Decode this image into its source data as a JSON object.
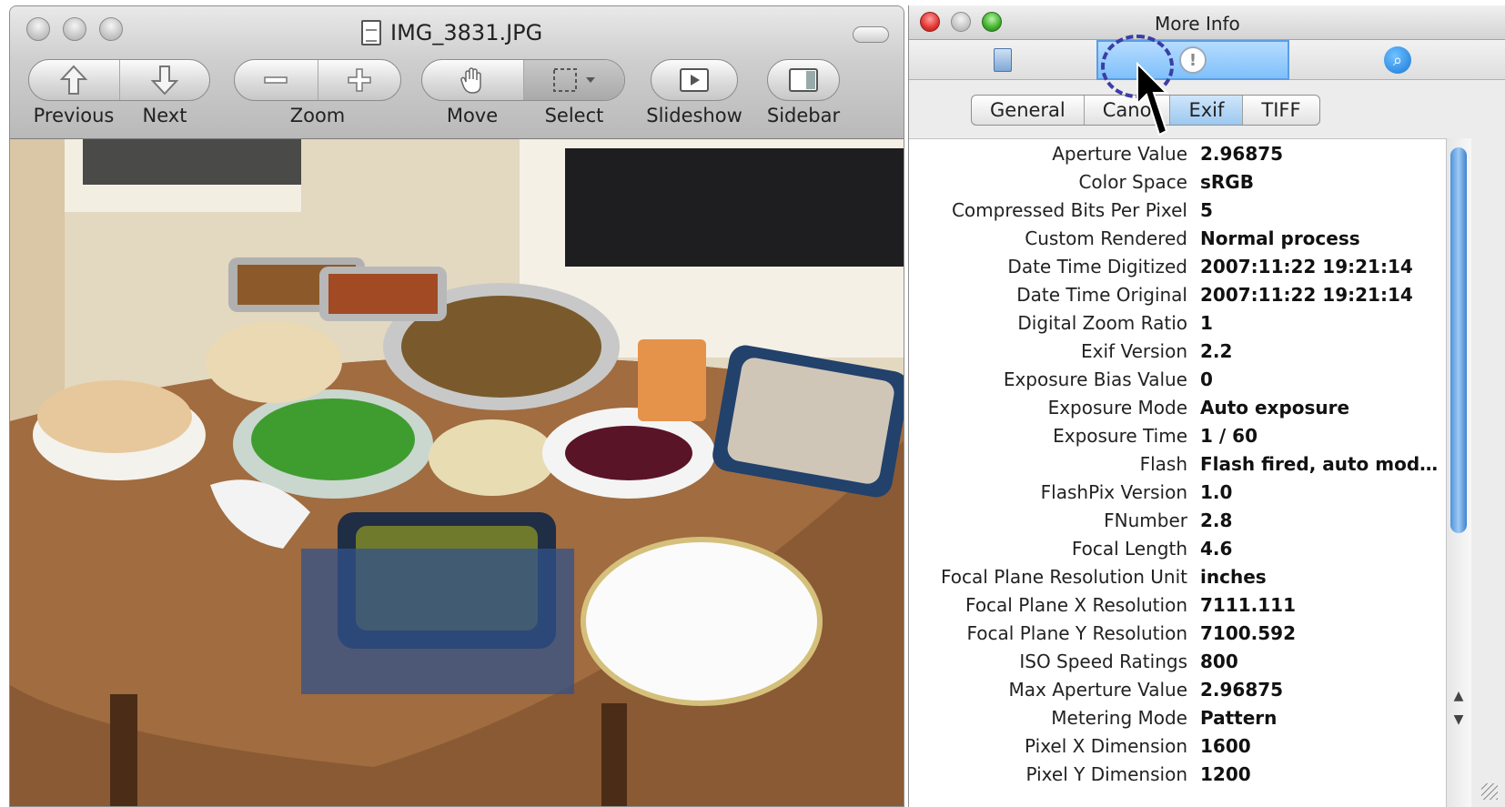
{
  "preview": {
    "title": "IMG_3831.JPG",
    "toolbar": {
      "previous": "Previous",
      "next": "Next",
      "zoom": "Zoom",
      "move": "Move",
      "select": "Select",
      "slideshow": "Slideshow",
      "sidebar": "Sidebar"
    }
  },
  "more_info": {
    "title": "More Info",
    "tabs": [
      "General",
      "Cano",
      "Exif",
      "TIFF"
    ],
    "active_tab": "Exif",
    "rows": [
      {
        "key": "Aperture Value",
        "value": "2.96875"
      },
      {
        "key": "Color Space",
        "value": "sRGB"
      },
      {
        "key": "Compressed Bits Per Pixel",
        "value": "5"
      },
      {
        "key": "Custom Rendered",
        "value": "Normal process"
      },
      {
        "key": "Date Time Digitized",
        "value": "2007:11:22 19:21:14"
      },
      {
        "key": "Date Time Original",
        "value": "2007:11:22 19:21:14"
      },
      {
        "key": "Digital Zoom Ratio",
        "value": "1"
      },
      {
        "key": "Exif Version",
        "value": "2.2"
      },
      {
        "key": "Exposure Bias Value",
        "value": "0"
      },
      {
        "key": "Exposure Mode",
        "value": "Auto exposure"
      },
      {
        "key": "Exposure Time",
        "value": "1 / 60"
      },
      {
        "key": "Flash",
        "value": "Flash fired, auto mod…"
      },
      {
        "key": "FlashPix Version",
        "value": "1.0"
      },
      {
        "key": "FNumber",
        "value": "2.8"
      },
      {
        "key": "Focal Length",
        "value": "4.6"
      },
      {
        "key": "Focal Plane Resolution Unit",
        "value": "inches"
      },
      {
        "key": "Focal Plane X Resolution",
        "value": "7111.111"
      },
      {
        "key": "Focal Plane Y Resolution",
        "value": "7100.592"
      },
      {
        "key": "ISO Speed Ratings",
        "value": "800"
      },
      {
        "key": "Max Aperture Value",
        "value": "2.96875"
      },
      {
        "key": "Metering Mode",
        "value": "Pattern"
      },
      {
        "key": "Pixel X Dimension",
        "value": "1600"
      },
      {
        "key": "Pixel Y Dimension",
        "value": "1200"
      }
    ]
  },
  "colors": {
    "selected_blue": "#7fc0fa",
    "annotation_circle": "#3b3ea3",
    "close_red": "#e0332f",
    "zoom_green": "#3fae2b"
  }
}
